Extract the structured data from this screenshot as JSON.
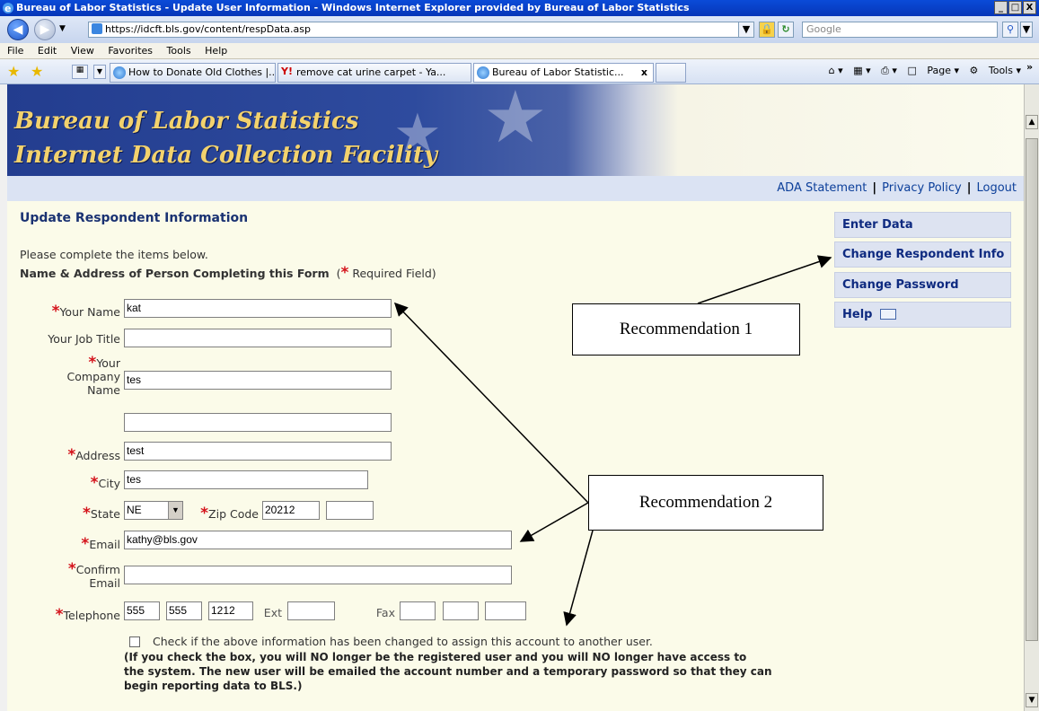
{
  "window": {
    "title": "Bureau of Labor Statistics - Update User Information - Windows Internet Explorer provided by Bureau of Labor Statistics",
    "controls": [
      "_",
      "□",
      "X"
    ]
  },
  "address": {
    "url": "https://idcft.bls.gov/content/respData.asp",
    "search_placeholder": "Google"
  },
  "menu": [
    "File",
    "Edit",
    "View",
    "Favorites",
    "Tools",
    "Help"
  ],
  "tabs": [
    {
      "label": "How to Donate Old Clothes |..."
    },
    {
      "label": "remove cat urine carpet - Ya..."
    },
    {
      "label": "Bureau of Labor Statistic...",
      "close": "x"
    }
  ],
  "command_bar": {
    "page": "Page",
    "tools": "Tools"
  },
  "banner": {
    "line1": "Bureau of Labor Statistics",
    "line2": "Internet Data Collection Facility"
  },
  "top_links": {
    "ada": "ADA Statement",
    "privacy": "Privacy Policy",
    "logout": "Logout",
    "sep": "|"
  },
  "page": {
    "heading": "Update Respondent Information",
    "intro": "Please complete the items below.",
    "section": "Name & Address of Person Completing this Form",
    "required_open": "(",
    "required_star": "*",
    "required_note": "Required Field)"
  },
  "form": {
    "star": "*",
    "name_label": "Your Name",
    "name_value": "kat",
    "job_label": "Your Job Title",
    "job_value": "",
    "company_label_1": "Your",
    "company_label_2": "Company",
    "company_label_3": "Name",
    "company_value": "tes",
    "company_value2": "",
    "address_label": "Address",
    "address_value": "test",
    "city_label": "City",
    "city_value": "tes",
    "state_label": "State",
    "state_value": "NE",
    "zip_label": "Zip Code",
    "zip_value": "20212",
    "zip_ext_value": "",
    "email_label": "Email",
    "email_value": "kathy@bls.gov",
    "confirm_label_1": "Confirm",
    "confirm_label_2": "Email",
    "confirm_value": "",
    "phone_label": "Telephone",
    "phone_area": "555",
    "phone_prefix": "555",
    "phone_line": "1212",
    "ext_label": "Ext",
    "ext_value": "",
    "fax_label": "Fax",
    "check_label": "Check if the above information has been changed to assign this account to another user.",
    "warning_1": "(If you check the box, you will NO longer be the registered user and you will NO longer have access to",
    "warning_2": "the system. The new user will be emailed the account number and a temporary password so that they can",
    "warning_3": "begin reporting data to BLS.)"
  },
  "side_menu": [
    {
      "label": "Enter Data"
    },
    {
      "label": "Change Respondent Info"
    },
    {
      "label": "Change Password"
    },
    {
      "label": "Help"
    }
  ],
  "callouts": {
    "rec1": "Recommendation 1",
    "rec2": "Recommendation 2"
  }
}
